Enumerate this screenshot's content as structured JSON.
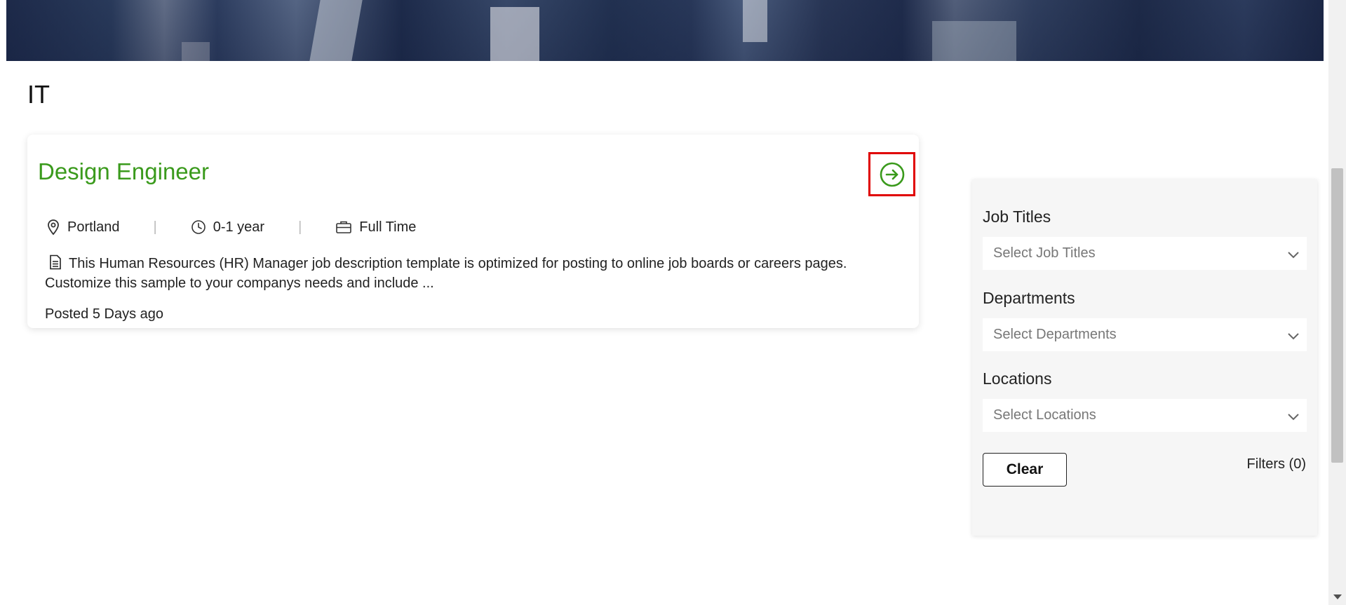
{
  "section": {
    "title": "IT"
  },
  "job": {
    "title": "Design Engineer",
    "location": "Portland",
    "experience": "0-1 year",
    "type": "Full Time",
    "description": "This Human Resources (HR) Manager job description template is optimized for posting to online job boards or careers pages. Customize this sample to your companys needs and include ...",
    "posted": "Posted 5 Days ago",
    "separator": "|"
  },
  "filters": {
    "job_titles_label": "Job Titles",
    "job_titles_placeholder": "Select Job Titles",
    "departments_label": "Departments",
    "departments_placeholder": "Select Departments",
    "locations_label": "Locations",
    "locations_placeholder": "Select Locations",
    "clear_label": "Clear",
    "count_label": "Filters (0)"
  },
  "colors": {
    "accent_green": "#3a9a1c",
    "highlight_red": "#e00000"
  },
  "icons": {
    "arrow": "arrow-right-circle-icon",
    "location": "map-pin-icon",
    "experience": "clock-icon",
    "type": "briefcase-icon",
    "description": "document-icon",
    "dropdown": "chevron-down-icon"
  }
}
